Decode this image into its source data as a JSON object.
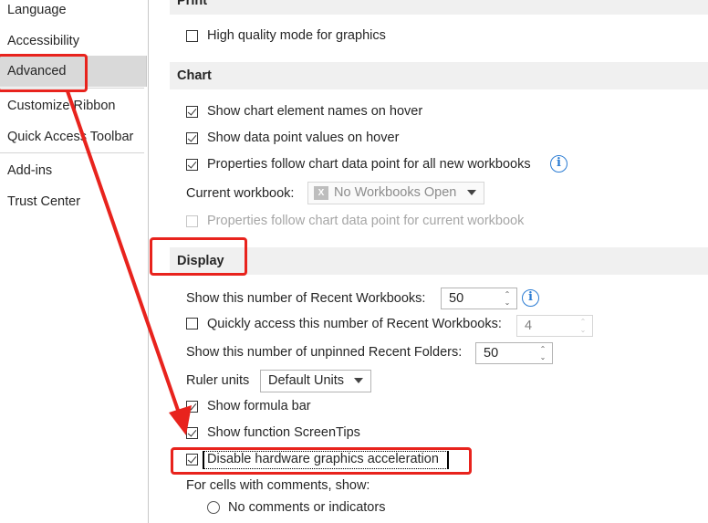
{
  "sidebar": {
    "items": [
      {
        "label": "Language"
      },
      {
        "label": "Accessibility"
      },
      {
        "label": "Advanced",
        "selected": true
      },
      {
        "label": "Customize Ribbon"
      },
      {
        "label": "Quick Access Toolbar"
      },
      {
        "label": "Add-ins"
      },
      {
        "label": "Trust Center"
      }
    ]
  },
  "print": {
    "header": "Print",
    "high_quality": {
      "label": "High quality mode for graphics",
      "checked": false
    }
  },
  "chart": {
    "header": "Chart",
    "element_names": {
      "label": "Show chart element names on hover",
      "checked": true
    },
    "data_values": {
      "label": "Show data point values on hover",
      "checked": true
    },
    "follow_all": {
      "label": "Properties follow chart data point for all new workbooks",
      "checked": true
    },
    "current_workbook_label": "Current workbook:",
    "current_workbook_value": "No Workbooks Open",
    "follow_current": {
      "label": "Properties follow chart data point for current workbook",
      "checked": false,
      "disabled": true
    }
  },
  "display": {
    "header": "Display",
    "recent_workbooks_label": "Show this number of Recent Workbooks:",
    "recent_workbooks_value": "50",
    "quick_access": {
      "label": "Quickly access this number of Recent Workbooks:",
      "checked": false
    },
    "quick_access_value": "4",
    "recent_folders_label": "Show this number of unpinned Recent Folders:",
    "recent_folders_value": "50",
    "ruler_label": "Ruler units",
    "ruler_value": "Default Units",
    "formula_bar": {
      "label": "Show formula bar",
      "checked": true
    },
    "screentips": {
      "label": "Show function ScreenTips",
      "checked": true
    },
    "disable_hw": {
      "label": "Disable hardware graphics acceleration",
      "checked": true
    },
    "comments_label": "For cells with comments, show:",
    "no_comments": {
      "label": "No comments or indicators",
      "selected": false
    }
  },
  "colors": {
    "annotation_red": "#e8231d",
    "info_blue": "#2b7cd3"
  },
  "icons": [
    "info-icon",
    "excel-icon",
    "dropdown-chevron-icon",
    "spinner-arrows-icon",
    "checkmark-icon"
  ]
}
